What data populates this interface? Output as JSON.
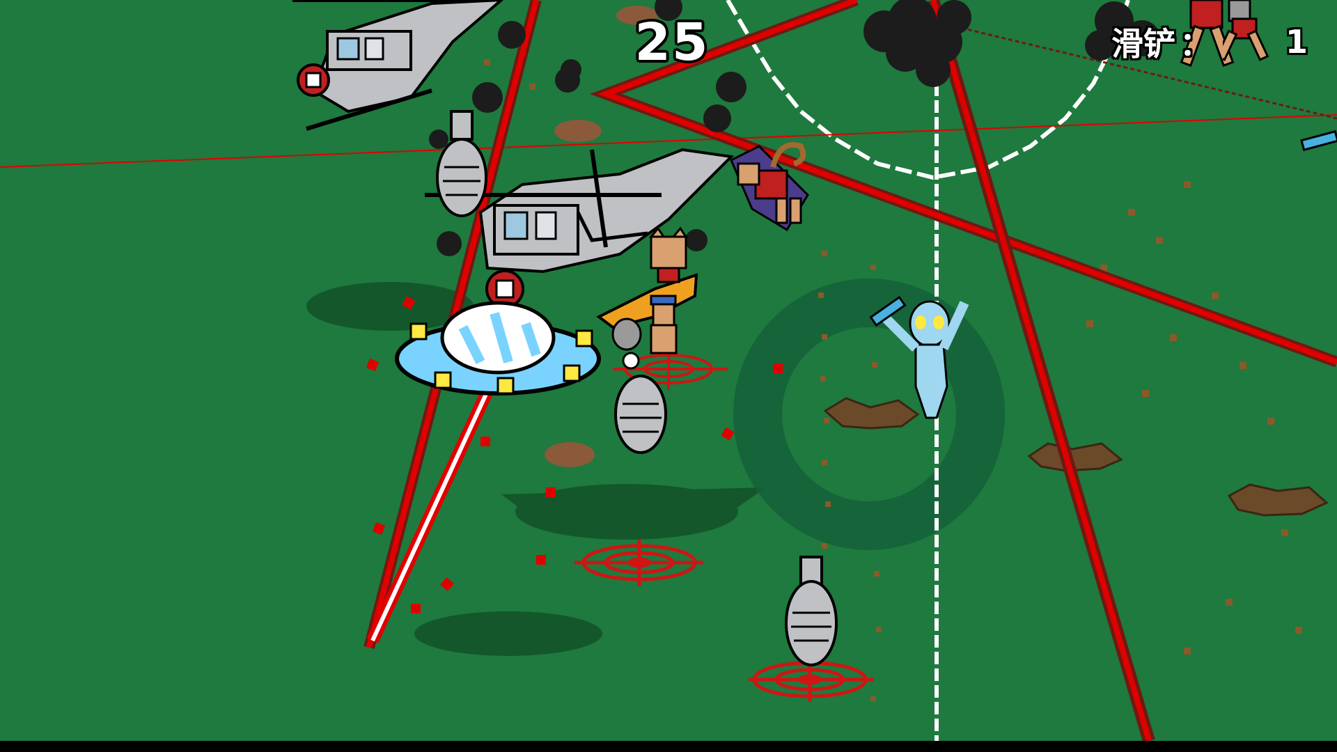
{
  "hud": {
    "score": "25",
    "counter_label": "滑铲",
    "counter_separator": "：",
    "counter_value": "1",
    "counter_icon": "sliding-runner-icon"
  },
  "colors": {
    "field": "#1e7a3e",
    "laser": "#e00000",
    "laser_dark": "#6e1a12",
    "target": "#d11414",
    "shadow": "#14572b",
    "ufo": "#7ad3ff",
    "helicopter": "#bfc1c4",
    "smoke": "#1c1c1c",
    "alien": "#9fd6f0"
  },
  "entities": [
    "helicopter",
    "helicopter",
    "ufo",
    "alien",
    "cat-pilot",
    "caped-hero",
    "falling-bomb",
    "falling-bomb",
    "falling-bomb",
    "target-marker",
    "target-marker",
    "target-marker",
    "crater",
    "crater",
    "crater",
    "smoke-cloud"
  ]
}
